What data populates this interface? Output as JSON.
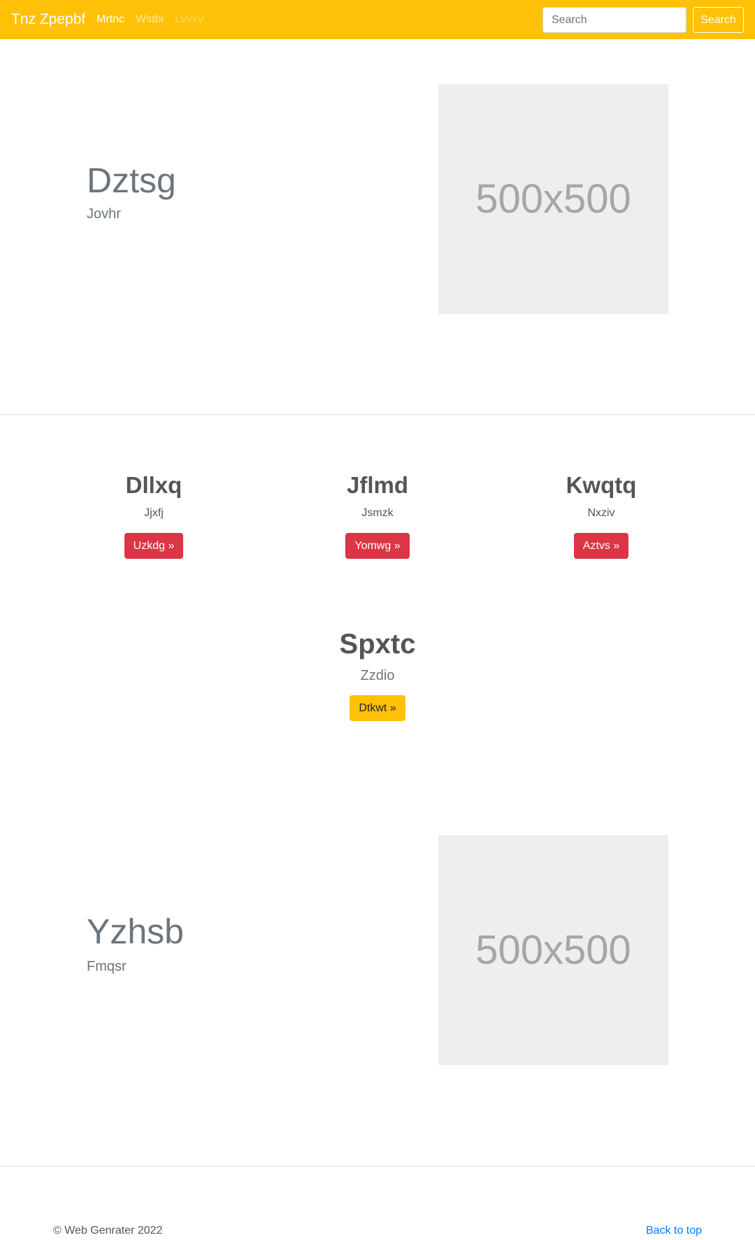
{
  "navbar": {
    "brand": "Tnz Zpepbf",
    "links": [
      "Mrtnc",
      "Wstbi",
      "Lvvxv"
    ],
    "search_placeholder": "Search",
    "search_button": "Search"
  },
  "hero1": {
    "title": "Dztsg",
    "subtitle": "Jovhr",
    "image_label": "500x500"
  },
  "features": [
    {
      "title": "Dllxq",
      "subtitle": "Jjxfj",
      "button": "Uzkdg »"
    },
    {
      "title": "Jflmd",
      "subtitle": "Jsmzk",
      "button": "Yomwg »"
    },
    {
      "title": "Kwqtq",
      "subtitle": "Nxziv",
      "button": "Aztvs »"
    }
  ],
  "center_feature": {
    "title": "Spxtc",
    "subtitle": "Zzdio",
    "button": "Dtkwt »"
  },
  "hero2": {
    "title": "Yzhsb",
    "subtitle": "Fmqsr",
    "image_label": "500x500"
  },
  "footer": {
    "copyright": "© Web Genrater 2022",
    "back_to_top": "Back to top"
  }
}
